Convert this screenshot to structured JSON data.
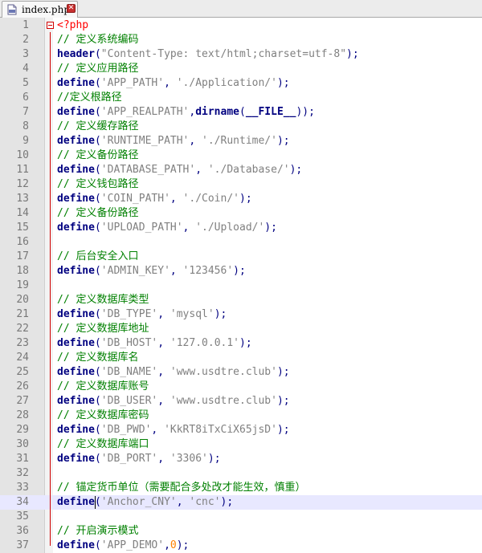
{
  "tab": {
    "title": "index.php",
    "close_glyph": "✕",
    "icon": "php-file-icon"
  },
  "editor": {
    "current_line": 34,
    "lines": [
      {
        "n": "1",
        "tokens": [
          {
            "t": "<?php",
            "c": "php"
          }
        ]
      },
      {
        "n": "2",
        "tokens": [
          {
            "t": "// 定义系统编码",
            "c": "comment"
          }
        ]
      },
      {
        "n": "3",
        "tokens": [
          {
            "t": "header",
            "c": "func"
          },
          {
            "t": "(",
            "c": "punct"
          },
          {
            "t": "\"Content-Type: text/html;charset=utf-8\"",
            "c": "string"
          },
          {
            "t": ");",
            "c": "punct"
          }
        ]
      },
      {
        "n": "4",
        "tokens": [
          {
            "t": "// 定义应用路径",
            "c": "comment"
          }
        ]
      },
      {
        "n": "5",
        "tokens": [
          {
            "t": "define",
            "c": "func"
          },
          {
            "t": "(",
            "c": "punct"
          },
          {
            "t": "'APP_PATH'",
            "c": "string"
          },
          {
            "t": ", ",
            "c": "punct"
          },
          {
            "t": "'./Application/'",
            "c": "string"
          },
          {
            "t": ");",
            "c": "punct"
          }
        ]
      },
      {
        "n": "6",
        "tokens": [
          {
            "t": "//定义根路径",
            "c": "comment"
          }
        ]
      },
      {
        "n": "7",
        "tokens": [
          {
            "t": "define",
            "c": "func"
          },
          {
            "t": "(",
            "c": "punct"
          },
          {
            "t": "'APP_REALPATH'",
            "c": "string"
          },
          {
            "t": ",",
            "c": "punct"
          },
          {
            "t": "dirname",
            "c": "func"
          },
          {
            "t": "(",
            "c": "punct"
          },
          {
            "t": "__FILE__",
            "c": "const"
          },
          {
            "t": "));",
            "c": "punct"
          }
        ]
      },
      {
        "n": "8",
        "tokens": [
          {
            "t": "// 定义缓存路径",
            "c": "comment"
          }
        ]
      },
      {
        "n": "9",
        "tokens": [
          {
            "t": "define",
            "c": "func"
          },
          {
            "t": "(",
            "c": "punct"
          },
          {
            "t": "'RUNTIME_PATH'",
            "c": "string"
          },
          {
            "t": ", ",
            "c": "punct"
          },
          {
            "t": "'./Runtime/'",
            "c": "string"
          },
          {
            "t": ");",
            "c": "punct"
          }
        ]
      },
      {
        "n": "10",
        "tokens": [
          {
            "t": "// 定义备份路径",
            "c": "comment"
          }
        ]
      },
      {
        "n": "11",
        "tokens": [
          {
            "t": "define",
            "c": "func"
          },
          {
            "t": "(",
            "c": "punct"
          },
          {
            "t": "'DATABASE_PATH'",
            "c": "string"
          },
          {
            "t": ", ",
            "c": "punct"
          },
          {
            "t": "'./Database/'",
            "c": "string"
          },
          {
            "t": ");",
            "c": "punct"
          }
        ]
      },
      {
        "n": "12",
        "tokens": [
          {
            "t": "// 定义钱包路径",
            "c": "comment"
          }
        ]
      },
      {
        "n": "13",
        "tokens": [
          {
            "t": "define",
            "c": "func"
          },
          {
            "t": "(",
            "c": "punct"
          },
          {
            "t": "'COIN_PATH'",
            "c": "string"
          },
          {
            "t": ", ",
            "c": "punct"
          },
          {
            "t": "'./Coin/'",
            "c": "string"
          },
          {
            "t": ");",
            "c": "punct"
          }
        ]
      },
      {
        "n": "14",
        "tokens": [
          {
            "t": "// 定义备份路径",
            "c": "comment"
          }
        ]
      },
      {
        "n": "15",
        "tokens": [
          {
            "t": "define",
            "c": "func"
          },
          {
            "t": "(",
            "c": "punct"
          },
          {
            "t": "'UPLOAD_PATH'",
            "c": "string"
          },
          {
            "t": ", ",
            "c": "punct"
          },
          {
            "t": "'./Upload/'",
            "c": "string"
          },
          {
            "t": ");",
            "c": "punct"
          }
        ]
      },
      {
        "n": "16",
        "tokens": []
      },
      {
        "n": "17",
        "tokens": [
          {
            "t": "// 后台安全入口",
            "c": "comment"
          }
        ]
      },
      {
        "n": "18",
        "tokens": [
          {
            "t": "define",
            "c": "func"
          },
          {
            "t": "(",
            "c": "punct"
          },
          {
            "t": "'ADMIN_KEY'",
            "c": "string"
          },
          {
            "t": ", ",
            "c": "punct"
          },
          {
            "t": "'123456'",
            "c": "string"
          },
          {
            "t": ");",
            "c": "punct"
          }
        ]
      },
      {
        "n": "19",
        "tokens": []
      },
      {
        "n": "20",
        "tokens": [
          {
            "t": "// 定义数据库类型",
            "c": "comment"
          }
        ]
      },
      {
        "n": "21",
        "tokens": [
          {
            "t": "define",
            "c": "func"
          },
          {
            "t": "(",
            "c": "punct"
          },
          {
            "t": "'DB_TYPE'",
            "c": "string"
          },
          {
            "t": ", ",
            "c": "punct"
          },
          {
            "t": "'mysql'",
            "c": "string"
          },
          {
            "t": ");",
            "c": "punct"
          }
        ]
      },
      {
        "n": "22",
        "tokens": [
          {
            "t": "// 定义数据库地址",
            "c": "comment"
          }
        ]
      },
      {
        "n": "23",
        "tokens": [
          {
            "t": "define",
            "c": "func"
          },
          {
            "t": "(",
            "c": "punct"
          },
          {
            "t": "'DB_HOST'",
            "c": "string"
          },
          {
            "t": ", ",
            "c": "punct"
          },
          {
            "t": "'127.0.0.1'",
            "c": "string"
          },
          {
            "t": ");",
            "c": "punct"
          }
        ]
      },
      {
        "n": "24",
        "tokens": [
          {
            "t": "// 定义数据库名",
            "c": "comment"
          }
        ]
      },
      {
        "n": "25",
        "tokens": [
          {
            "t": "define",
            "c": "func"
          },
          {
            "t": "(",
            "c": "punct"
          },
          {
            "t": "'DB_NAME'",
            "c": "string"
          },
          {
            "t": ", ",
            "c": "punct"
          },
          {
            "t": "'www.usdtre.club'",
            "c": "string"
          },
          {
            "t": ");",
            "c": "punct"
          }
        ]
      },
      {
        "n": "26",
        "tokens": [
          {
            "t": "// 定义数据库账号",
            "c": "comment"
          }
        ]
      },
      {
        "n": "27",
        "tokens": [
          {
            "t": "define",
            "c": "func"
          },
          {
            "t": "(",
            "c": "punct"
          },
          {
            "t": "'DB_USER'",
            "c": "string"
          },
          {
            "t": ", ",
            "c": "punct"
          },
          {
            "t": "'www.usdtre.club'",
            "c": "string"
          },
          {
            "t": ");",
            "c": "punct"
          }
        ]
      },
      {
        "n": "28",
        "tokens": [
          {
            "t": "// 定义数据库密码",
            "c": "comment"
          }
        ]
      },
      {
        "n": "29",
        "tokens": [
          {
            "t": "define",
            "c": "func"
          },
          {
            "t": "(",
            "c": "punct"
          },
          {
            "t": "'DB_PWD'",
            "c": "string"
          },
          {
            "t": ", ",
            "c": "punct"
          },
          {
            "t": "'KkRT8iTxCiX65jsD'",
            "c": "string"
          },
          {
            "t": ");",
            "c": "punct"
          }
        ]
      },
      {
        "n": "30",
        "tokens": [
          {
            "t": "// 定义数据库端口",
            "c": "comment"
          }
        ]
      },
      {
        "n": "31",
        "tokens": [
          {
            "t": "define",
            "c": "func"
          },
          {
            "t": "(",
            "c": "punct"
          },
          {
            "t": "'DB_PORT'",
            "c": "string"
          },
          {
            "t": ", ",
            "c": "punct"
          },
          {
            "t": "'3306'",
            "c": "string"
          },
          {
            "t": ");",
            "c": "punct"
          }
        ]
      },
      {
        "n": "32",
        "tokens": []
      },
      {
        "n": "33",
        "tokens": [
          {
            "t": "// 锚定货币单位（需要配合多处改才能生效，慎重）",
            "c": "comment"
          }
        ]
      },
      {
        "n": "34",
        "tokens": [
          {
            "t": "define",
            "c": "func"
          },
          {
            "t": "(",
            "c": "punct"
          },
          {
            "t": "'Anchor_CNY'",
            "c": "string"
          },
          {
            "t": ", ",
            "c": "punct"
          },
          {
            "t": "'cnc'",
            "c": "string"
          },
          {
            "t": ");",
            "c": "punct"
          }
        ]
      },
      {
        "n": "35",
        "tokens": []
      },
      {
        "n": "36",
        "tokens": [
          {
            "t": "// 开启演示模式",
            "c": "comment"
          }
        ]
      },
      {
        "n": "37",
        "tokens": [
          {
            "t": "define",
            "c": "func"
          },
          {
            "t": "(",
            "c": "punct"
          },
          {
            "t": "'APP_DEMO'",
            "c": "string"
          },
          {
            "t": ",",
            "c": "punct"
          },
          {
            "t": "0",
            "c": "num"
          },
          {
            "t": ");",
            "c": "punct"
          }
        ]
      }
    ]
  }
}
